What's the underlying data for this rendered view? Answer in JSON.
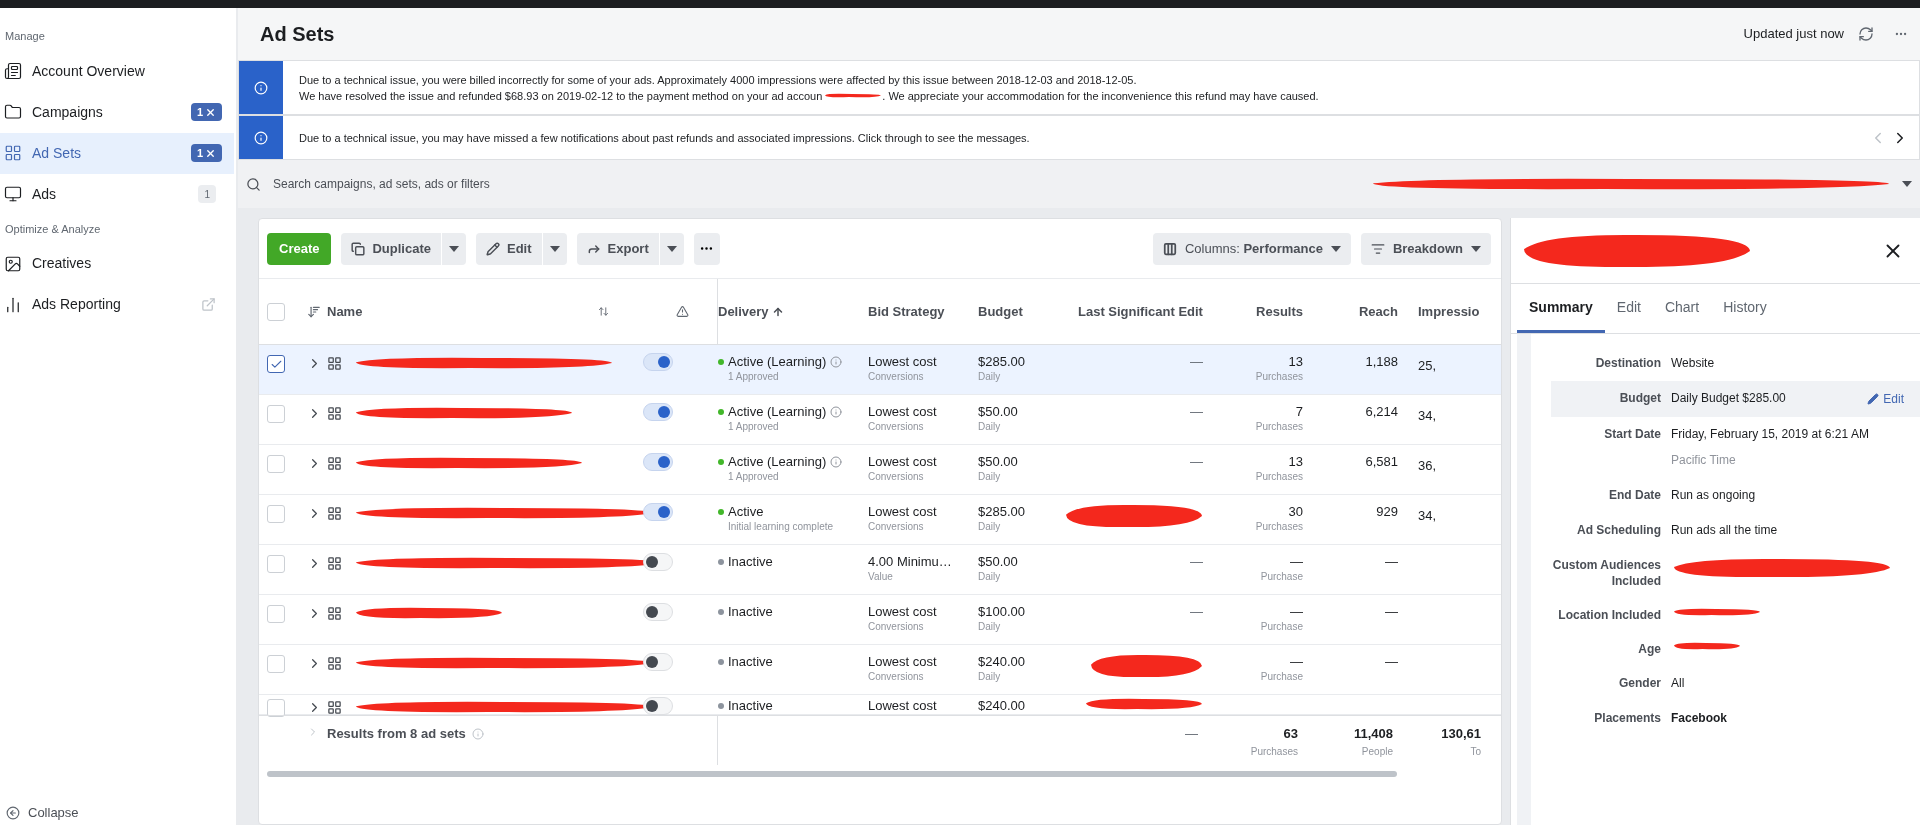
{
  "sidebar": {
    "sections": [
      {
        "title": "Manage",
        "items": [
          {
            "label": "Account Overview",
            "selected": false
          },
          {
            "label": "Campaigns",
            "selected": false,
            "badge": {
              "text": "1",
              "kind": "filter"
            }
          },
          {
            "label": "Ad Sets",
            "selected": true,
            "badge": {
              "text": "1",
              "kind": "filter"
            }
          },
          {
            "label": "Ads",
            "selected": false,
            "badge": {
              "text": "1",
              "kind": "count"
            }
          }
        ]
      },
      {
        "title": "Optimize & Analyze",
        "items": [
          {
            "label": "Creatives",
            "selected": false
          },
          {
            "label": "Ads Reporting",
            "selected": false,
            "external": true
          }
        ]
      }
    ],
    "collapse": "Collapse"
  },
  "header": {
    "title": "Ad Sets",
    "status": "Updated just now"
  },
  "notices": [
    {
      "lines": [
        "Due to a technical issue, you were billed incorrectly for some of your ads. Approximately 4000 impressions were affected by this issue between 2018-12-03 and 2018-12-05.",
        "We have resolved the issue and refunded $68.93 on 2019-02-12 to the payment method on your ad accoun",
        ". We appreciate your accommodation for the inconvenience this refund may have caused."
      ]
    },
    {
      "lines": [
        "Due to a technical issue, you may have missed a few notifications about past refunds and associated impressions. Click through to see the messages."
      ],
      "pager": true
    }
  ],
  "search": {
    "placeholder": "Search campaigns, ad sets, ads or filters"
  },
  "toolbar": {
    "create": "Create",
    "actions": [
      {
        "label": "Duplicate"
      },
      {
        "label": "Edit"
      },
      {
        "label": "Export"
      }
    ],
    "columns": "Columns: **Performance**",
    "breakdown": "Breakdown"
  },
  "table": {
    "select_all_checked": false,
    "columns": [
      {
        "label": "Name",
        "sorted": false
      },
      {
        "label": "Delivery",
        "sorted": true
      },
      {
        "label": "Bid Strategy",
        "sorted": false
      },
      {
        "label": "Budget",
        "sorted": false
      },
      {
        "label": "Last Significant Edit",
        "sorted": false
      },
      {
        "label": "Results",
        "sorted": false
      },
      {
        "label": "Reach",
        "sorted": false
      },
      {
        "label": "Impressio",
        "sorted": false
      }
    ],
    "rows": [
      {
        "selected": true,
        "checked": true,
        "on": true,
        "delivery": {
          "status": "Active (Learning)",
          "detail": "1 Approved",
          "color": "#42b72a",
          "info": true
        },
        "bid": "Lowest cost",
        "bid_type": "Conversions",
        "budget": "$285.00",
        "budget_type": "Daily",
        "last_edit": "—",
        "results": "13",
        "results_type": "Purchases",
        "reach": "1,188",
        "impressions": "25,"
      },
      {
        "selected": false,
        "checked": false,
        "on": true,
        "delivery": {
          "status": "Active (Learning)",
          "detail": "1 Approved",
          "color": "#42b72a",
          "info": true
        },
        "bid": "Lowest cost",
        "bid_type": "Conversions",
        "budget": "$50.00",
        "budget_type": "Daily",
        "last_edit": "—",
        "results": "7",
        "results_type": "Purchases",
        "reach": "6,214",
        "impressions": "34,"
      },
      {
        "selected": false,
        "checked": false,
        "on": true,
        "delivery": {
          "status": "Active (Learning)",
          "detail": "1 Approved",
          "color": "#42b72a",
          "info": true
        },
        "bid": "Lowest cost",
        "bid_type": "Conversions",
        "budget": "$50.00",
        "budget_type": "Daily",
        "last_edit": "—",
        "results": "13",
        "results_type": "Purchases",
        "reach": "6,581",
        "impressions": "36,"
      },
      {
        "selected": false,
        "checked": false,
        "on": true,
        "delivery": {
          "status": "Active",
          "detail": "Initial learning complete",
          "color": "#42b72a"
        },
        "bid": "Lowest cost",
        "bid_type": "Conversions",
        "budget": "$285.00",
        "budget_type": "Daily",
        "results": "30",
        "results_type": "Purchases",
        "reach": "929",
        "impressions": "34,"
      },
      {
        "selected": false,
        "checked": false,
        "on": false,
        "delivery": {
          "status": "Inactive",
          "color": "#8d949e"
        },
        "bid": "4.00 Minimu…",
        "bid_type": "Value",
        "budget": "$50.00",
        "budget_type": "Daily",
        "last_edit": "—",
        "results": "—",
        "results_type": "Purchase",
        "reach": "—"
      },
      {
        "selected": false,
        "checked": false,
        "on": false,
        "delivery": {
          "status": "Inactive",
          "color": "#8d949e"
        },
        "bid": "Lowest cost",
        "bid_type": "Conversions",
        "budget": "$100.00",
        "budget_type": "Daily",
        "last_edit": "—",
        "results": "—",
        "results_type": "Purchase",
        "reach": "—"
      },
      {
        "selected": false,
        "checked": false,
        "on": false,
        "delivery": {
          "status": "Inactive",
          "color": "#8d949e"
        },
        "bid": "Lowest cost",
        "bid_type": "Conversions",
        "budget": "$240.00",
        "budget_type": "Daily",
        "results": "—",
        "results_type": "Purchase",
        "reach": "—"
      },
      {
        "selected": false,
        "checked": false,
        "on": false,
        "delivery": {
          "status": "Inactive",
          "color": "#8d949e"
        },
        "bid": "Lowest cost",
        "budget": "$240.00"
      }
    ],
    "footer": {
      "label": "Results from 8 ad sets",
      "last_edit": "—",
      "results": "63",
      "results_type": "Purchases",
      "reach": "11,408",
      "reach_type": "People",
      "impressions": "130,61",
      "impressions_type": "To"
    }
  },
  "panel": {
    "tabs": [
      {
        "label": "Summary",
        "selected": true
      },
      {
        "label": "Edit",
        "selected": false
      },
      {
        "label": "Chart",
        "selected": false
      },
      {
        "label": "History",
        "selected": false
      }
    ],
    "fields": [
      {
        "label": "Destination",
        "value": "Website"
      },
      {
        "label": "Budget",
        "value": "Daily Budget $285.00",
        "highlighted": true,
        "action": "Edit"
      },
      {
        "label": "Start Date",
        "value": "Friday, February 15, 2019 at 6:21 AM",
        "note": "Pacific Time"
      },
      {
        "label": "End Date",
        "value": "Run as ongoing"
      },
      {
        "label": "Ad Scheduling",
        "value": "Run ads all the time"
      },
      {
        "label": "Custom Audiences Included"
      },
      {
        "label": "Location Included"
      },
      {
        "label": "Age"
      },
      {
        "label": "Gender",
        "value": "All"
      },
      {
        "label": "Placements",
        "value": "Facebook",
        "bold": true
      }
    ]
  }
}
